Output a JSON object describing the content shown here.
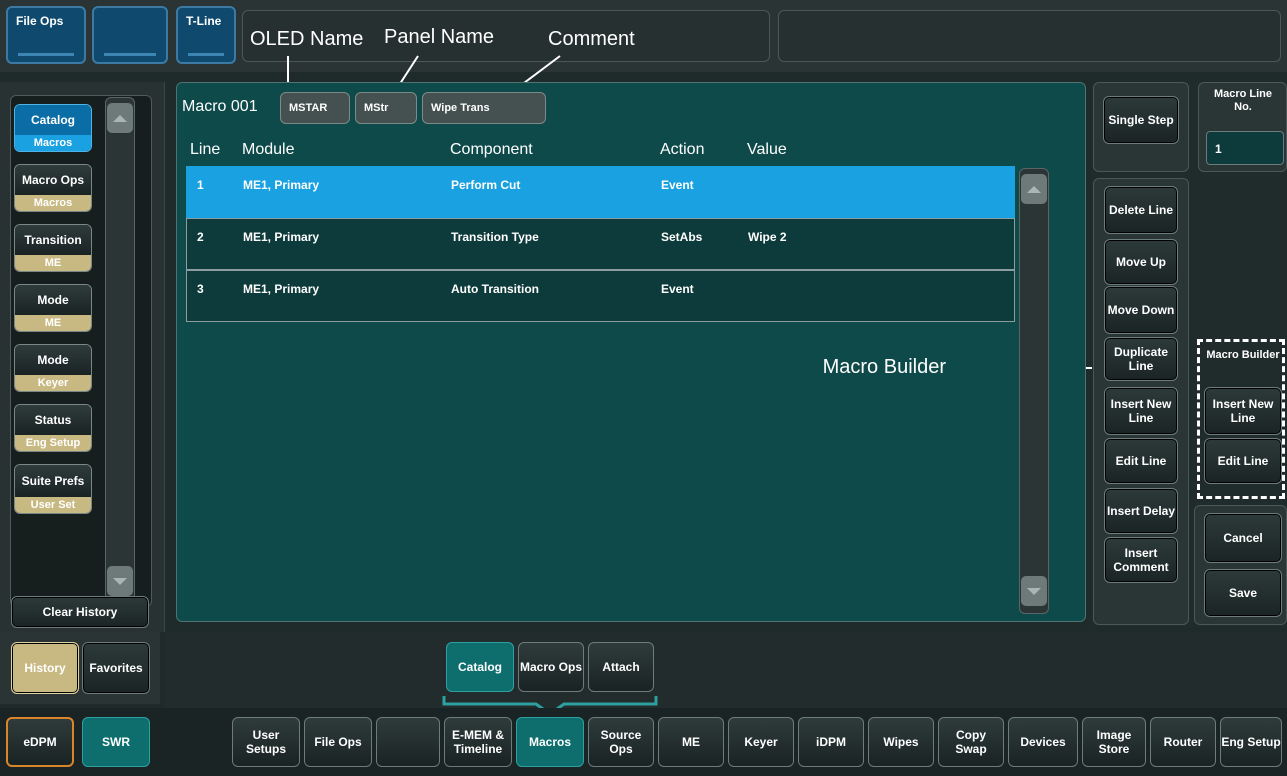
{
  "top": {
    "file_ops": "File Ops",
    "blank": "",
    "tline": "T-Line"
  },
  "callouts": {
    "oled": "OLED Name",
    "panel": "Panel Name",
    "comment": "Comment",
    "builder": "Macro Builder"
  },
  "nav": {
    "items": [
      {
        "title": "Catalog",
        "sub": "Macros"
      },
      {
        "title": "Macro Ops",
        "sub": "Macros"
      },
      {
        "title": "Transition",
        "sub": "ME"
      },
      {
        "title": "Mode",
        "sub": "ME"
      },
      {
        "title": "Mode",
        "sub": "Keyer"
      },
      {
        "title": "Status",
        "sub": "Eng Setup"
      },
      {
        "title": "Suite Prefs",
        "sub": "User Set"
      }
    ],
    "clear_history": "Clear History",
    "history": "History",
    "favorites": "Favorites"
  },
  "macro": {
    "name": "Macro 001",
    "oled_name": "MSTAR",
    "panel_name": "MStr",
    "comment": "Wipe Trans"
  },
  "table": {
    "headers": [
      "Line",
      "Module",
      "Component",
      "Action",
      "Value"
    ],
    "rows": [
      {
        "line": "1",
        "module": "ME1, Primary",
        "component": "Perform Cut",
        "action": "Event",
        "value": ""
      },
      {
        "line": "2",
        "module": "ME1, Primary",
        "component": "Transition Type",
        "action": "SetAbs",
        "value": "Wipe 2"
      },
      {
        "line": "3",
        "module": "ME1, Primary",
        "component": "Auto Transition",
        "action": "Event",
        "value": ""
      }
    ]
  },
  "right": {
    "single_step": "Single Step",
    "line_no_label": "Macro Line No.",
    "line_no_value": "1",
    "delete_line": "Delete Line",
    "move_up": "Move Up",
    "move_down": "Move Down",
    "duplicate_line": "Duplicate Line",
    "insert_new_line": "Insert New Line",
    "edit_line": "Edit Line",
    "insert_delay": "Insert Delay",
    "insert_comment": "Insert Comment",
    "builder_label": "Macro Builder",
    "builder_insert": "Insert New Line",
    "builder_edit": "Edit Line",
    "cancel": "Cancel",
    "save": "Save"
  },
  "subtabs": [
    "Catalog",
    "Macro Ops",
    "Attach"
  ],
  "bottom": {
    "edpm": "eDPM",
    "swr": "SWR",
    "items": [
      "User Setups",
      "File Ops",
      "",
      "E-MEM & Timeline",
      "Macros",
      "Source Ops",
      "ME",
      "Keyer",
      "iDPM",
      "Wipes",
      "Copy Swap",
      "Devices",
      "Image Store",
      "Router",
      "Eng Setup"
    ]
  }
}
